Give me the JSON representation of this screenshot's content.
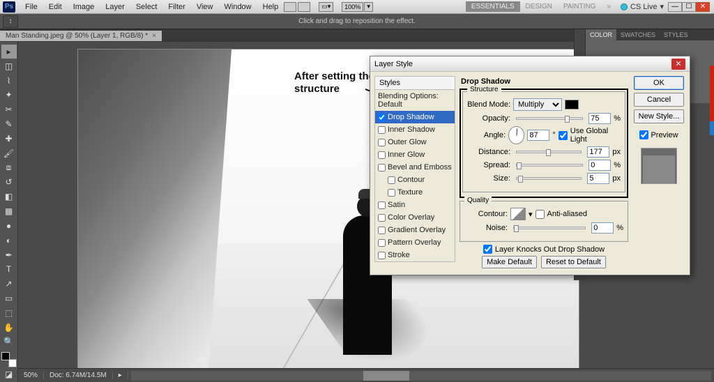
{
  "menubar": {
    "items": [
      "File",
      "Edit",
      "Image",
      "Layer",
      "Select",
      "Filter",
      "View",
      "Window",
      "Help"
    ],
    "zoom": "100%",
    "workspaces": [
      "ESSENTIALS",
      "DESIGN",
      "PAINTING"
    ],
    "cslive": "CS Live"
  },
  "optbar": {
    "hint": "Click and drag to reposition the effect."
  },
  "doctab": {
    "title": "Man Standing.jpeg @ 50% (Layer 1, RGB/8) *"
  },
  "annotation": {
    "line1": "After setting the",
    "line2": "structure"
  },
  "panels": {
    "tabs": [
      "COLOR",
      "SWATCHES",
      "STYLES"
    ]
  },
  "status": {
    "zoom": "50%",
    "doc": "Doc: 6.74M/14.5M"
  },
  "dialog": {
    "title": "Layer Style",
    "styles_head": "Styles",
    "styles": [
      {
        "label": "Blending Options: Default",
        "cb": false,
        "sel": false
      },
      {
        "label": "Drop Shadow",
        "cb": true,
        "checked": true,
        "sel": true
      },
      {
        "label": "Inner Shadow",
        "cb": true,
        "checked": false
      },
      {
        "label": "Outer Glow",
        "cb": true,
        "checked": false
      },
      {
        "label": "Inner Glow",
        "cb": true,
        "checked": false
      },
      {
        "label": "Bevel and Emboss",
        "cb": true,
        "checked": false
      },
      {
        "label": "Contour",
        "cb": true,
        "checked": false,
        "indent": true
      },
      {
        "label": "Texture",
        "cb": true,
        "checked": false,
        "indent": true
      },
      {
        "label": "Satin",
        "cb": true,
        "checked": false
      },
      {
        "label": "Color Overlay",
        "cb": true,
        "checked": false
      },
      {
        "label": "Gradient Overlay",
        "cb": true,
        "checked": false
      },
      {
        "label": "Pattern Overlay",
        "cb": true,
        "checked": false
      },
      {
        "label": "Stroke",
        "cb": true,
        "checked": false
      }
    ],
    "section": "Drop Shadow",
    "structure_title": "Structure",
    "blend_mode_label": "Blend Mode:",
    "blend_mode_value": "Multiply",
    "opacity_label": "Opacity:",
    "opacity_value": "75",
    "opacity_unit": "%",
    "angle_label": "Angle:",
    "angle_value": "87",
    "angle_unit": "°",
    "global_light": "Use Global Light",
    "distance_label": "Distance:",
    "distance_value": "177",
    "px": "px",
    "spread_label": "Spread:",
    "spread_value": "0",
    "size_label": "Size:",
    "size_value": "5",
    "quality_title": "Quality",
    "contour_label": "Contour:",
    "antialiased": "Anti-aliased",
    "noise_label": "Noise:",
    "noise_value": "0",
    "knockout": "Layer Knocks Out Drop Shadow",
    "make_default": "Make Default",
    "reset_default": "Reset to Default",
    "ok": "OK",
    "cancel": "Cancel",
    "new_style": "New Style...",
    "preview": "Preview"
  }
}
